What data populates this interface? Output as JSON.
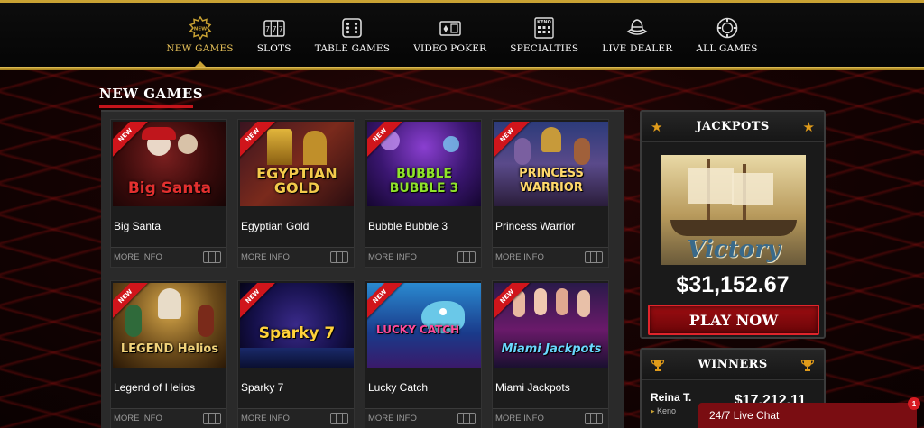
{
  "nav": {
    "items": [
      {
        "label": "NEW GAMES",
        "icon": "new-badge-icon",
        "active": true
      },
      {
        "label": "SLOTS",
        "icon": "slot-reels-icon",
        "active": false
      },
      {
        "label": "TABLE GAMES",
        "icon": "dice-icon",
        "active": false
      },
      {
        "label": "VIDEO POKER",
        "icon": "cards-icon",
        "active": false
      },
      {
        "label": "SPECIALTIES",
        "icon": "keno-board-icon",
        "active": false
      },
      {
        "label": "LIVE DEALER",
        "icon": "dealer-hat-icon",
        "active": false
      },
      {
        "label": "ALL GAMES",
        "icon": "chip-icon",
        "active": false
      }
    ],
    "new_icon_text": "NEW",
    "keno_icon_text": "KENO"
  },
  "section": {
    "title": "NEW GAMES"
  },
  "games": [
    {
      "name": "Big Santa",
      "badge": "NEW",
      "more_info": "MORE INFO",
      "logo": "Big Santa"
    },
    {
      "name": "Egyptian Gold",
      "badge": "NEW",
      "more_info": "MORE INFO",
      "logo": "EGYPTIAN GOLD"
    },
    {
      "name": "Bubble Bubble 3",
      "badge": "NEW",
      "more_info": "MORE INFO",
      "logo": "BUBBLE BUBBLE 3"
    },
    {
      "name": "Princess Warrior",
      "badge": "NEW",
      "more_info": "MORE INFO",
      "logo": "PRINCESS WARRIOR"
    },
    {
      "name": "Legend of Helios",
      "badge": "NEW",
      "more_info": "MORE INFO",
      "logo": "LEGEND Helios"
    },
    {
      "name": "Sparky 7",
      "badge": "NEW",
      "more_info": "MORE INFO",
      "logo": "Sparky 7"
    },
    {
      "name": "Lucky Catch",
      "badge": "NEW",
      "more_info": "MORE INFO",
      "logo": "LUCKY CATCH"
    },
    {
      "name": "Miami Jackpots",
      "badge": "NEW",
      "more_info": "MORE INFO",
      "logo": "Miami Jackpots"
    }
  ],
  "jackpots": {
    "title": "JACKPOTS",
    "game_logo": "Victory",
    "amount": "$31,152.67",
    "play_label": "PLAY NOW"
  },
  "winners": {
    "title": "WINNERS",
    "entries": [
      {
        "name": "Reina T.",
        "game": "Keno",
        "amount": "$17,212.11"
      }
    ]
  },
  "live_chat": {
    "label": "24/7 Live Chat",
    "badge": "1"
  },
  "colors": {
    "gold": "#c9a233",
    "red": "#c4141b",
    "panel": "#2a2a2a"
  }
}
